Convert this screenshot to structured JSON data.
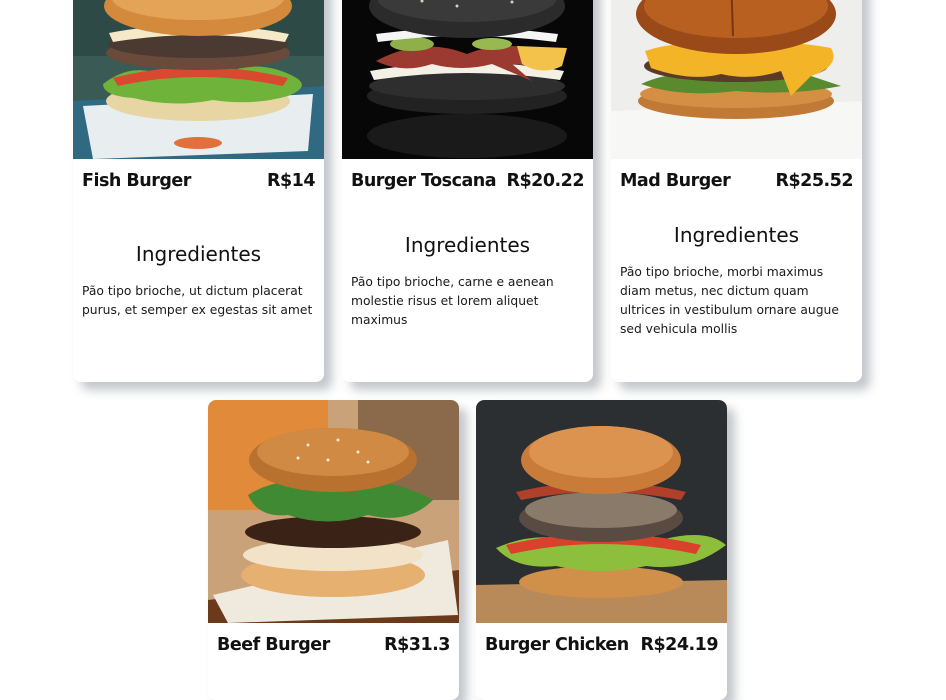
{
  "menu": {
    "cards": [
      {
        "name": "Fish Burger",
        "price": "R$14",
        "ingredients_title": "Ingredientes",
        "ingredients": "Pão tipo brioche, ut dictum placerat purus, et semper ex egestas sit amet"
      },
      {
        "name": "Burger Toscana",
        "price": "R$20.22",
        "ingredients_title": "Ingredientes",
        "ingredients": "Pão tipo brioche, carne e aenean molestie risus et lorem aliquet maximus"
      },
      {
        "name": "Mad Burger",
        "price": "R$25.52",
        "ingredients_title": "Ingredientes",
        "ingredients": "Pão tipo brioche, morbi maximus diam metus, nec dictum quam ultrices in vestibulum ornare augue sed vehicula mollis"
      },
      {
        "name": "Beef Burger",
        "price": "R$31.3"
      },
      {
        "name": "Burger Chicken",
        "price": "R$24.19"
      }
    ]
  },
  "colors": {
    "page_background": "#ffffff",
    "card_background": "#ffffff",
    "text": "#111111"
  }
}
